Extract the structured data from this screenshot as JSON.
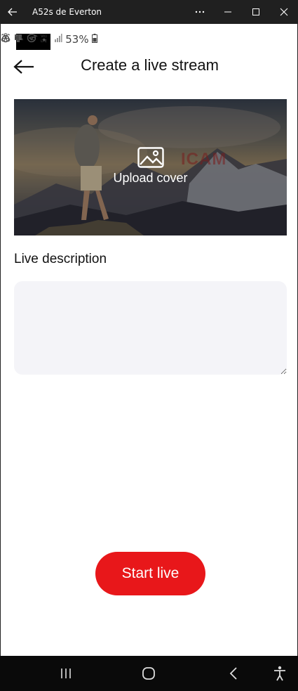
{
  "window": {
    "title": "A52s de Everton",
    "back_icon": "arrow-left-icon",
    "minimize_icon": "minimize-icon",
    "maximize_icon": "maximize-icon",
    "close_icon": "close-icon"
  },
  "status_bar": {
    "battery_percent": "53%",
    "dot": "•"
  },
  "header": {
    "title": "Create a live stream"
  },
  "cover": {
    "label": "Upload cover",
    "watermark": "ICAM",
    "icon": "image-icon"
  },
  "description": {
    "label": "Live description",
    "value": "",
    "placeholder": ""
  },
  "actions": {
    "start_label": "Start live",
    "accent_color": "#e8171a"
  },
  "nav": {
    "recents_icon": "recents-icon",
    "home_icon": "home-icon",
    "back_icon": "back-icon",
    "accessibility_icon": "accessibility-icon"
  }
}
